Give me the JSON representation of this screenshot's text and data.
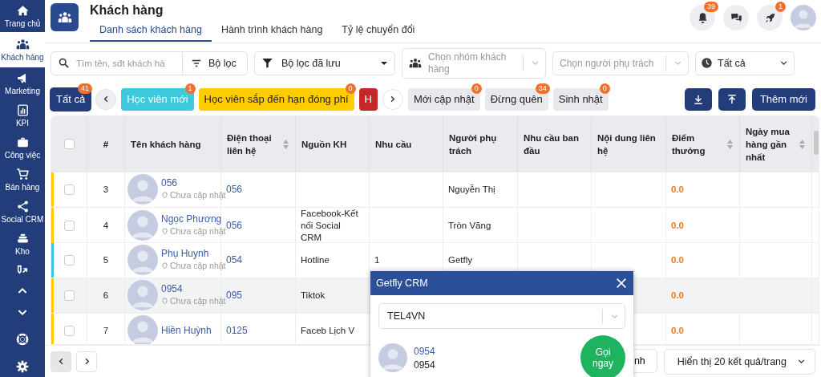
{
  "sidebar": {
    "items": [
      {
        "label": "Trang chủ",
        "selected": false
      },
      {
        "label": "Khách hàng",
        "selected": true
      },
      {
        "label": "Marketing",
        "selected": false
      },
      {
        "label": "KPI",
        "selected": false
      },
      {
        "label": "Công việc",
        "selected": false
      },
      {
        "label": "Bán hàng",
        "selected": false
      },
      {
        "label": "Social CRM",
        "selected": false
      },
      {
        "label": "Kho",
        "selected": false
      }
    ]
  },
  "header": {
    "title": "Khách hàng",
    "tabs": [
      {
        "label": "Danh sách khách hàng",
        "selected": true
      },
      {
        "label": "Hành trình khách hàng",
        "selected": false
      },
      {
        "label": "Tỷ lệ chuyển đổi",
        "selected": false
      }
    ],
    "notifications": "39",
    "rocket_badge": "1"
  },
  "filters": {
    "search": {
      "placeholder": "Tìm tên, sđt khách hà"
    },
    "filter_button": "Bộ lọc",
    "saved_filter": "Bộ lọc đã lưu",
    "group_select": {
      "placeholder": "Chọn nhóm khách hàng"
    },
    "owner_select": {
      "placeholder": "Chọn người phụ trách"
    },
    "time_select": "Tất cả"
  },
  "chips": [
    {
      "label": "Tất cả",
      "count": "41",
      "color": "#233c7a",
      "selected": true
    },
    {
      "label": "Học viên mới",
      "count": "1",
      "color": "#3ec8de",
      "selected": false
    },
    {
      "label": "Học viên sắp đến hạn đóng phí",
      "count": "0",
      "color": "#ffcc00",
      "selected": false
    },
    {
      "label": "H",
      "color": "#c62828",
      "selected": false
    },
    {
      "label": "Mới cập nhật",
      "count": "0",
      "color": "#e8e9ec",
      "selected": false
    },
    {
      "label": "Đừng quên",
      "count": "34",
      "color": "#e8e9ec",
      "selected": false
    },
    {
      "label": "Sinh nhật",
      "count": "0",
      "color": "#e8e9ec",
      "selected": false
    }
  ],
  "add_button": "Thêm mới",
  "table": {
    "select_all_checked": false,
    "columns": [
      {
        "label": "#",
        "sortable": false
      },
      {
        "label": "Tên khách hàng",
        "sortable": false
      },
      {
        "label": "Điện thoại liên hệ",
        "sortable": true
      },
      {
        "label": "Nguồn KH",
        "sortable": false
      },
      {
        "label": "Nhu cầu",
        "sortable": false
      },
      {
        "label": "Người phụ trách",
        "sortable": false
      },
      {
        "label": "Nhu cầu ban đầu",
        "sortable": false
      },
      {
        "label": "Nội dung liên hệ",
        "sortable": false
      },
      {
        "label": "Điểm thưởng",
        "sortable": true
      },
      {
        "label": "Ngày mua hàng gần nhất",
        "sortable": true
      }
    ],
    "rows": [
      {
        "number": "3",
        "name": "056",
        "location": "Chưa cập nhật",
        "phone": "056",
        "owner": "Nguyễn Thị",
        "score": "0.0",
        "color": "#ffcc00",
        "checked": false,
        "hovered": false
      },
      {
        "number": "4",
        "name": "Ngọc Phương",
        "location": "Chưa cập nhật",
        "phone": "056",
        "source": "Facebook-Kết nối Social CRM",
        "owner": "Tròn Văng",
        "score": "0.0",
        "color": "#ffcc00",
        "checked": false,
        "hovered": false
      },
      {
        "number": "5",
        "name": "Phụ Huynh",
        "location": "Chưa cập nhật",
        "phone": "054",
        "source": "Hotline",
        "need": "1",
        "owner": "Getfly",
        "score": "0.0",
        "color": "#3ec8de",
        "checked": false,
        "hovered": false
      },
      {
        "number": "6",
        "name": "0954",
        "location": "Chưa cập nhật",
        "phone": "095",
        "source": "Tiktok",
        "score": "0.0",
        "color": "#ffcc00",
        "checked": false,
        "hovered": true
      },
      {
        "number": "7",
        "name": "Hiền Huỳnh",
        "phone": "0125",
        "source": "Faceb Lịch V",
        "score": "0.0",
        "color": "#ffcc00",
        "checked": false,
        "hovered": false
      }
    ]
  },
  "footer": {
    "partial_button": "nh",
    "page_size": "Hiển thị 20 kết quả/trang"
  },
  "popup": {
    "title": "Getfly CRM",
    "provider": "TEL4VN",
    "contact_name": "0954",
    "contact_phone": "0954",
    "call_button": "Gọi ngay"
  }
}
